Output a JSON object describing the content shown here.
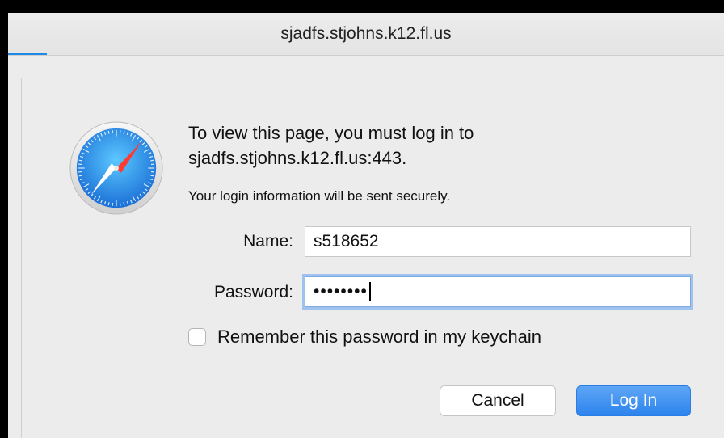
{
  "window": {
    "tab_title": "sjadfs.stjohns.k12.fl.us"
  },
  "dialog": {
    "icon": "safari-compass-icon",
    "prompt_line1": "To view this page, you must log in to",
    "prompt_line2": "sjadfs.stjohns.k12.fl.us:443.",
    "secure_note": "Your login information will be sent securely.",
    "name_label": "Name:",
    "name_value": "s518652",
    "password_label": "Password:",
    "password_value": "••••••••",
    "remember_label": "Remember this password in my keychain",
    "remember_checked": false,
    "cancel_label": "Cancel",
    "login_label": "Log In",
    "accent_color": "#2d84ee"
  }
}
